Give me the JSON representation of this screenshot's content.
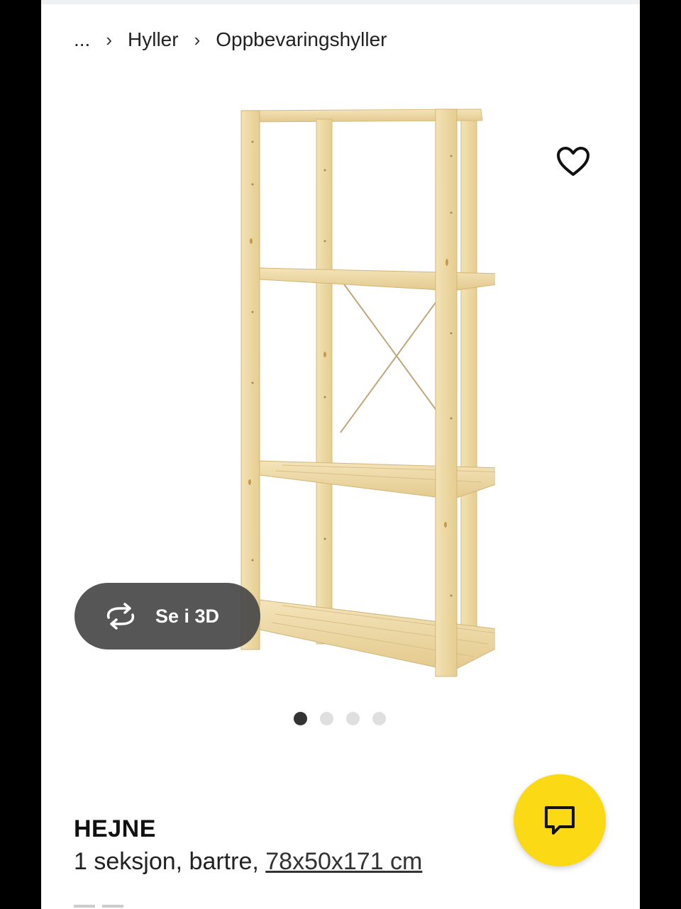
{
  "breadcrumb": {
    "ellipsis": "...",
    "separator": "›",
    "items": [
      "Hyller",
      "Oppbevaringshyller"
    ]
  },
  "gallery": {
    "view_3d_label": "Se i 3D",
    "dot_count": 4,
    "active_index": 0
  },
  "product": {
    "name": "HEJNE",
    "description": "1 seksjon, bartre,",
    "dimensions": "78x50x171 cm"
  },
  "icons": {
    "favorite": "heart-icon",
    "rotate": "rotate-3d-icon",
    "chat": "chat-icon"
  },
  "colors": {
    "chat_button": "#fbd914",
    "view3d_button": "#484848",
    "wood": "#eed9a4"
  }
}
